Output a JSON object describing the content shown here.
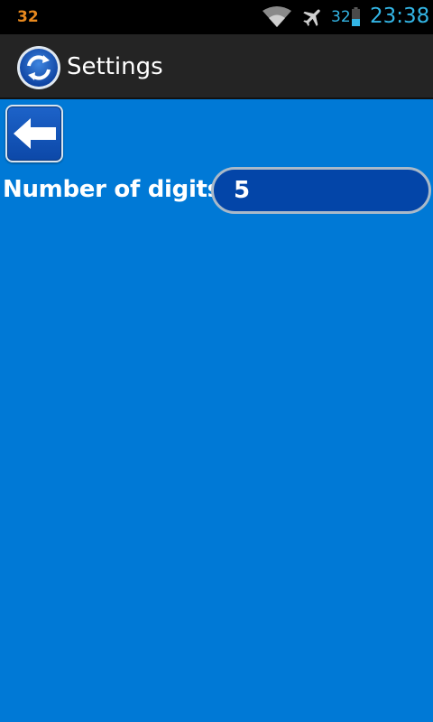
{
  "status_bar": {
    "notification_count": "32",
    "battery_level": "32",
    "time": "23:38",
    "icons": [
      "wifi-icon",
      "airplane-mode-icon",
      "battery-icon"
    ],
    "colors": {
      "clock": "#33b5e5",
      "notification": "#e8891e"
    }
  },
  "action_bar": {
    "title": "Settings",
    "app_icon": "sync-icon"
  },
  "settings": {
    "back_icon": "back-arrow-icon",
    "digits_label": "Number of digits",
    "digits_value": "5"
  },
  "colors": {
    "background": "#0079d6",
    "action_bar": "#242424",
    "field": "#0345a8"
  }
}
